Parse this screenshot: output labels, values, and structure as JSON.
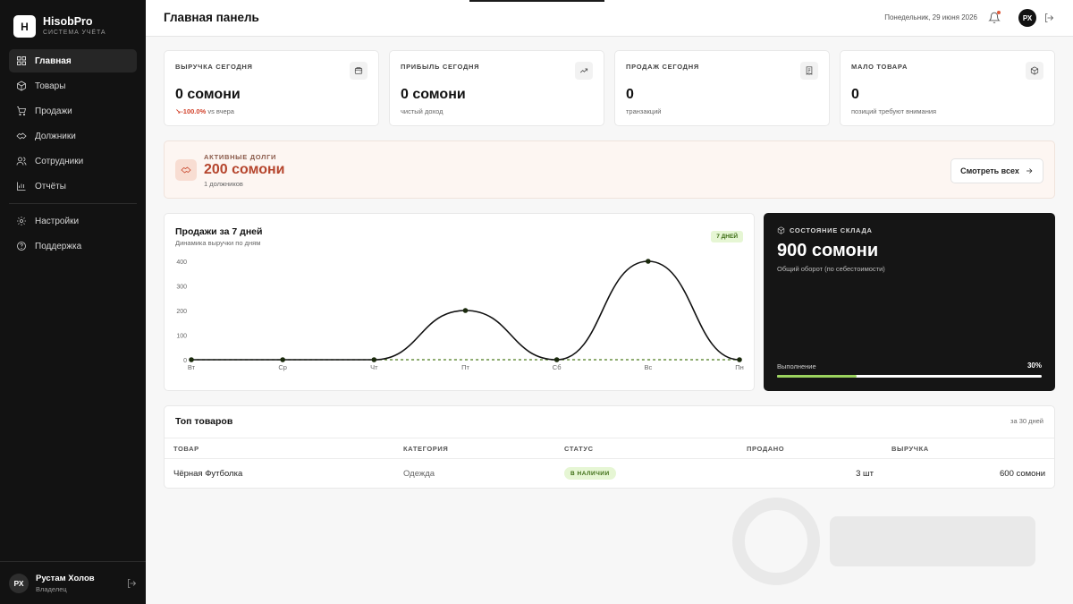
{
  "brand": {
    "logo_letter": "H",
    "name": "HisobPro",
    "subtitle": "СИСТЕМА УЧЁТА"
  },
  "sidebar": {
    "items": [
      {
        "label": "Главная",
        "icon": "dashboard-icon",
        "active": true
      },
      {
        "label": "Товары",
        "icon": "box-icon"
      },
      {
        "label": "Продажи",
        "icon": "cart-icon"
      },
      {
        "label": "Должники",
        "icon": "handshake-icon"
      },
      {
        "label": "Сотрудники",
        "icon": "users-icon"
      },
      {
        "label": "Отчёты",
        "icon": "bar-chart-icon"
      }
    ],
    "secondary": [
      {
        "label": "Настройки",
        "icon": "gear-icon"
      },
      {
        "label": "Поддержка",
        "icon": "help-icon"
      }
    ],
    "user": {
      "initials": "РХ",
      "name": "Рустам Холов",
      "role": "Владелец"
    }
  },
  "header": {
    "title": "Главная панель",
    "date": "Понедельник, 29 июня 2026",
    "initials": "РХ"
  },
  "stats": [
    {
      "label": "ВЫРУЧКА СЕГОДНЯ",
      "value": "0 сомони",
      "change": "-100.0%",
      "sub": "vs вчера",
      "icon": "wallet-icon"
    },
    {
      "label": "ПРИБЫЛЬ СЕГОДНЯ",
      "value": "0 сомони",
      "sub": "чистый доход",
      "icon": "trend-up-icon"
    },
    {
      "label": "ПРОДАЖ СЕГОДНЯ",
      "value": "0",
      "sub": "транзакций",
      "icon": "receipt-icon"
    },
    {
      "label": "МАЛО ТОВАРА",
      "value": "0",
      "sub": "позиций требуют внимания",
      "icon": "package-icon"
    }
  ],
  "debts": {
    "label": "АКТИВНЫЕ ДОЛГИ",
    "value": "200 сомони",
    "sub": "1 должников",
    "button": "Смотреть всех"
  },
  "sales_chart": {
    "title": "Продажи за 7 дней",
    "subtitle": "Динамика выручки по дням",
    "badge": "7 ДНЕЙ"
  },
  "chart_data": {
    "type": "line",
    "title": "Продажи за 7 дней",
    "categories": [
      "Вт",
      "Ср",
      "Чт",
      "Пт",
      "Сб",
      "Вс",
      "Пн"
    ],
    "series": [
      {
        "values": [
          0,
          0,
          0,
          200,
          0,
          400,
          0
        ],
        "color": "#111111",
        "style": "solid"
      },
      {
        "values": [
          0,
          0,
          0,
          0,
          0,
          0,
          0
        ],
        "color": "#4a7a1a",
        "style": "dashed"
      }
    ],
    "yticks": [
      0,
      100,
      200,
      300,
      400
    ],
    "ylim": [
      0,
      400
    ],
    "grid": false
  },
  "stock": {
    "label": "СОСТОЯНИЕ СКЛАДА",
    "value": "900 сомони",
    "sub": "Общий оборот (по себестоимости)",
    "progress_label": "Выполнение",
    "progress_text": "30%",
    "progress": 0.3,
    "accent": "#9bd35e"
  },
  "top_products": {
    "title": "Топ товаров",
    "period": "за 30 дней",
    "columns": [
      "ТОВАР",
      "КАТЕГОРИЯ",
      "СТАТУС",
      "ПРОДАНО",
      "ВЫРУЧКА"
    ],
    "rows": [
      {
        "name": "Чёрная Футболка",
        "category": "Одежда",
        "status": "В НАЛИЧИИ",
        "sold": "3 шт",
        "revenue": "600 сомони"
      }
    ]
  },
  "colors": {
    "sidebar_bg": "#121212",
    "accent_green": "#9bd35e",
    "debt_red": "#b5452d",
    "negative": "#d2422b"
  }
}
